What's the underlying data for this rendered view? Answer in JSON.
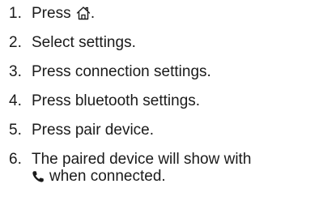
{
  "steps": [
    {
      "number": "1.",
      "before": "Press",
      "icon": "home-icon",
      "after": "."
    },
    {
      "number": "2.",
      "text": "Select settings."
    },
    {
      "number": "3.",
      "text": "Press connection settings."
    },
    {
      "number": "4.",
      "text": "Press bluetooth settings."
    },
    {
      "number": "5.",
      "text": "Press pair device."
    },
    {
      "number": "6.",
      "line1": "The paired device will show with",
      "icon": "phone-icon",
      "line2": "when connected."
    }
  ]
}
